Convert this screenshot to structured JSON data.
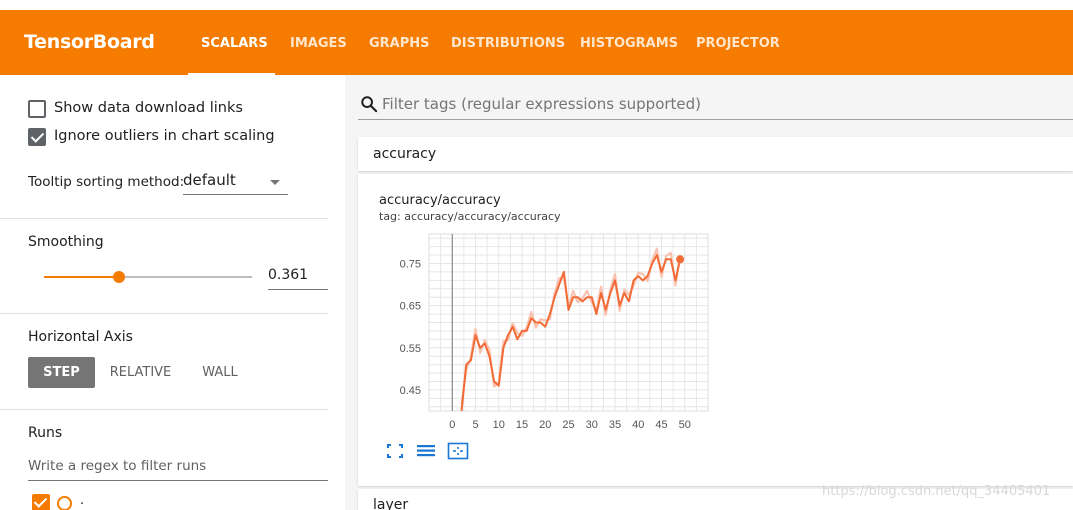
{
  "app": {
    "title": "TensorBoard"
  },
  "nav": {
    "tabs": [
      {
        "label": "SCALARS",
        "active": true
      },
      {
        "label": "IMAGES"
      },
      {
        "label": "GRAPHS"
      },
      {
        "label": "DISTRIBUTIONS"
      },
      {
        "label": "HISTOGRAMS"
      },
      {
        "label": "PROJECTOR"
      }
    ]
  },
  "sidebar": {
    "show_download_links": {
      "label": "Show data download links",
      "checked": false
    },
    "ignore_outliers": {
      "label": "Ignore outliers in chart scaling",
      "checked": true
    },
    "tooltip_sort": {
      "label": "Tooltip sorting method:",
      "value": "default"
    },
    "smoothing": {
      "label": "Smoothing",
      "value": "0.361",
      "fraction": 0.361
    },
    "horizontal_axis": {
      "label": "Horizontal Axis",
      "options": [
        "STEP",
        "RELATIVE",
        "WALL"
      ],
      "selected": "STEP"
    },
    "runs": {
      "label": "Runs",
      "filter_placeholder": "Write a regex to filter runs",
      "items": [
        {
          "name": ".",
          "checked": true
        }
      ]
    }
  },
  "main": {
    "search_placeholder": "Filter tags (regular expressions supported)",
    "groups": [
      {
        "title": "accuracy",
        "cards": [
          {
            "title": "accuracy/accuracy",
            "tag": "tag: accuracy/accuracy/accuracy"
          }
        ]
      },
      {
        "title": "layer"
      }
    ]
  },
  "colors": {
    "brand": "#f57c00",
    "series": "#f26a35",
    "series_raw": "#f9c3b0",
    "tool_icon": "#1976d2"
  },
  "icons": [
    "search-icon",
    "fullscreen-icon",
    "log-scale-icon",
    "fit-domain-icon"
  ],
  "chart_data": {
    "type": "line",
    "title": "accuracy/accuracy",
    "xlabel": "",
    "ylabel": "",
    "xlim": [
      -5,
      55
    ],
    "ylim": [
      0.4,
      0.82
    ],
    "x_ticks": [
      0,
      5,
      10,
      15,
      20,
      25,
      30,
      35,
      40,
      45,
      50
    ],
    "y_ticks": [
      0.45,
      0.55,
      0.65,
      0.75
    ],
    "grid": true,
    "series": [
      {
        "smoothed": true,
        "x": [
          2,
          3,
          4,
          5,
          6,
          7,
          8,
          9,
          10,
          11,
          12,
          13,
          14,
          15,
          16,
          17,
          18,
          19,
          20,
          21,
          22,
          23,
          24,
          25,
          26,
          27,
          28,
          29,
          30,
          31,
          32,
          33,
          34,
          35,
          36,
          37,
          38,
          39,
          40,
          41,
          42,
          43,
          44,
          45,
          46,
          47,
          48,
          49
        ],
        "values": [
          0.4,
          0.51,
          0.52,
          0.58,
          0.55,
          0.56,
          0.53,
          0.47,
          0.46,
          0.55,
          0.58,
          0.6,
          0.57,
          0.59,
          0.59,
          0.62,
          0.61,
          0.61,
          0.6,
          0.63,
          0.67,
          0.7,
          0.73,
          0.64,
          0.67,
          0.67,
          0.66,
          0.67,
          0.67,
          0.63,
          0.68,
          0.64,
          0.68,
          0.71,
          0.65,
          0.68,
          0.66,
          0.71,
          0.72,
          0.71,
          0.72,
          0.75,
          0.77,
          0.73,
          0.76,
          0.76,
          0.71,
          0.76
        ]
      }
    ]
  }
}
